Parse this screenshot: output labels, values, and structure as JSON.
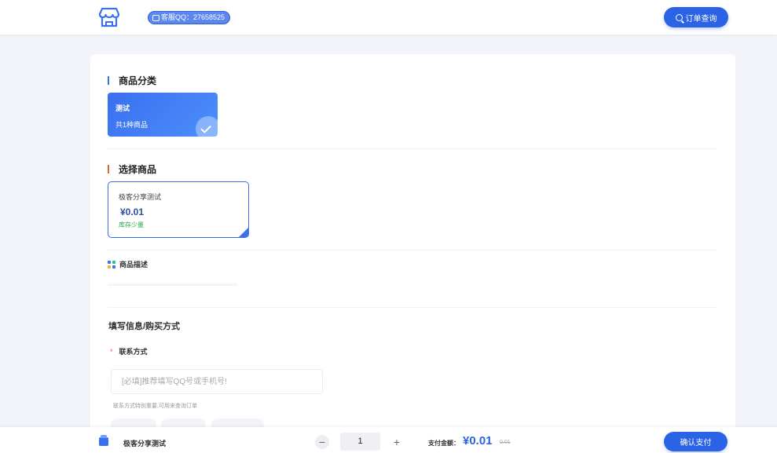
{
  "header": {
    "logo_icon": "storefront-icon",
    "qq_badge": "客服QQ：27658525",
    "order_query_label": "订单查询"
  },
  "category_section": {
    "title": "商品分类",
    "accent_color": "#3a6ff0",
    "categories": [
      {
        "name": "测试",
        "count_text": "共1种商品",
        "selected": true
      }
    ]
  },
  "product_section": {
    "title": "选择商品",
    "accent_color": "#e8632b",
    "products": [
      {
        "name": "极客分享测试",
        "price": "¥0.01",
        "stock": "库存少量",
        "selected": true
      }
    ]
  },
  "description": {
    "title": "商品描述"
  },
  "form": {
    "title": "填写信息/购买方式",
    "contact_label": "联系方式",
    "required_mark": "*",
    "contact_placeholder": "[必填]推荐填写QQ号或手机号!",
    "contact_value": "",
    "hint": "联系方式特别重要,可用来查询订单"
  },
  "bottom_bar": {
    "product_name": "极客分享测试",
    "quantity": "1",
    "minus_label": "−",
    "plus_label": "+",
    "pay_label": "支付金额：",
    "pay_amount": "¥0.01",
    "original_price": "0.01",
    "confirm_label": "确认支付"
  },
  "colors": {
    "primary": "#2b63e6",
    "stock_green": "#2aa84a"
  }
}
